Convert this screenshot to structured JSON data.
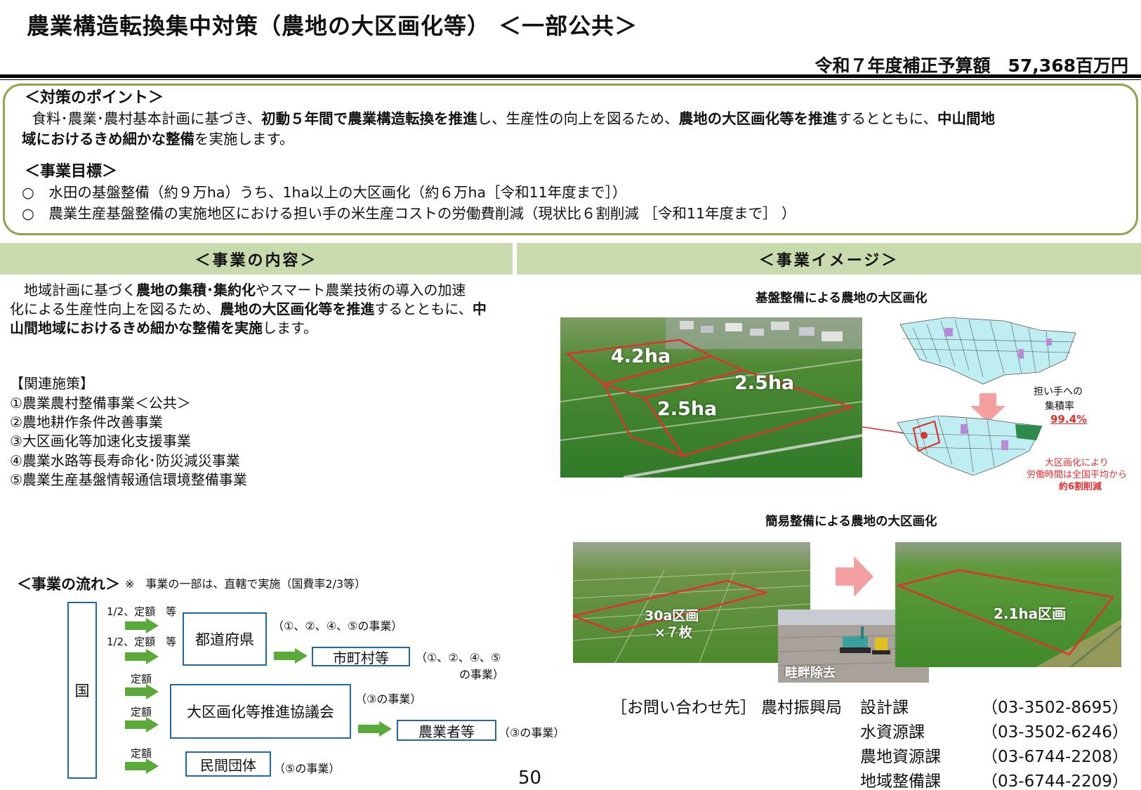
{
  "title": "農業構造転換集中対策（農地の大区画化等） ＜一部公共＞",
  "budget": "令和７年度補正予算額　57,368百万円",
  "points": {
    "heading": "＜対策のポイント＞",
    "line1_parts": [
      "　食料･農業･農村基本計画に基づき、",
      "初動５年間で農業構造転換を推進",
      "し、生産性の向上を図るため、",
      "農地の大区画化等を推進",
      "するとともに、",
      "中山間地"
    ],
    "line2_parts": [
      "域におけるきめ細かな整備",
      "を実施します。"
    ],
    "goals_heading": "＜事業目標＞",
    "goals": [
      "○　水田の基盤整備（約９万ha）うち、1ha以上の大区画化（約６万ha［令和11年度まで］）",
      "○　農業生産基盤整備の実施地区における担い手の米生産コストの労働費削減（現状比６割削減 ［令和11年度まで］ ）"
    ]
  },
  "sections": {
    "content_title": "＜事業の内容＞",
    "image_title": "＜事業イメージ＞"
  },
  "content": {
    "line1_parts": [
      "　地域計画に基づく",
      "農地の集積･集約化",
      "やスマート農業技術の導入の加速"
    ],
    "line2_parts": [
      "化による生産性向上を図るため、",
      "農地の大区画化等を推進",
      "するとともに、",
      "中"
    ],
    "line3_parts": [
      "山間地域におけるきめ細かな整備を実施",
      "します。"
    ],
    "related_heading": "【関連施策】",
    "related": [
      "①農業農村整備事業＜公共＞",
      "②農地耕作条件改善事業",
      "③大区画化等加速化支援事業",
      "④農業水路等長寿命化･防災減災事業",
      "⑤農業生産基盤情報通信環境整備事業"
    ]
  },
  "flow": {
    "heading": "＜事業の流れ＞",
    "note": "※　事業の一部は、直轄で実施（国費率2/3等）",
    "country": "国",
    "rate1": "1/2、定額　等",
    "rate2": "1/2、定額　等",
    "rate3": "定額",
    "rate4": "定額",
    "rate5": "定額",
    "prefecture": "都道府県",
    "prefecture_note": "（①、②、④、⑤の事業）",
    "municipality": "市町村等",
    "municipality_note1": "（①、②、④、⑤",
    "municipality_note2": "の事業）",
    "council": "大区画化等推進協議会",
    "council_note": "（③の事業）",
    "farmers": "農業者等",
    "farmers_note": "（③の事業）",
    "private": "民間団体",
    "private_note": "（⑤の事業）"
  },
  "image": {
    "caption1": "基盤整備による農地の大区画化",
    "field_a": "4.2ha",
    "field_b": "2.5ha",
    "field_c": "2.5ha",
    "concentration_label1": "担い手への",
    "concentration_label2": "集積率",
    "concentration_value": "99.4%",
    "labor_note1": "大区画化により",
    "labor_note2": "労働時間は全国平均から",
    "labor_note3": "約6割削減",
    "caption2": "簡易整備による農地の大区画化",
    "before_label1": "30a区画",
    "before_label2": "×７枚",
    "ridge_label": "畦畔除去",
    "after_label": "2.1ha区画"
  },
  "contact": {
    "label": "［お問い合わせ先］",
    "bureau": "農村振興局",
    "rows": [
      {
        "dept": "設計課",
        "tel": "（03-3502-8695）"
      },
      {
        "dept": "水資源課",
        "tel": "（03-3502-6246）"
      },
      {
        "dept": "農地資源課",
        "tel": "（03-6744-2208）"
      },
      {
        "dept": "地域整備課",
        "tel": "（03-6744-2209）"
      }
    ]
  },
  "page_number": "50",
  "colors": {
    "frame_green": "#8aa64c",
    "section_bar": "#c9dbac",
    "flow_blue": "#1f6aa6",
    "arrow_green": "#5aaa3a",
    "highlight_red": "#e03030",
    "pink_arrow": "#f4a0a0"
  }
}
